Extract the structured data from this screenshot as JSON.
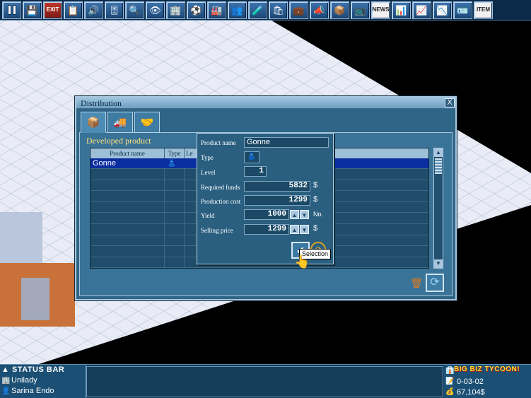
{
  "toolbar": {
    "buttons": [
      {
        "name": "pause",
        "icon": "pause-icon"
      },
      {
        "name": "save",
        "icon": "floppy-disk-icon",
        "glyph": "💾"
      },
      {
        "name": "exit",
        "label": "EXIT"
      },
      {
        "name": "menu",
        "icon": "notes-icon",
        "glyph": "📋"
      },
      {
        "name": "sound",
        "icon": "speaker-icon",
        "glyph": "🔊"
      },
      {
        "name": "settings",
        "icon": "sliders-icon",
        "glyph": "🎚"
      },
      {
        "name": "zoom",
        "icon": "magnifier-icon",
        "glyph": "🔍"
      },
      {
        "name": "view",
        "icon": "eye-icon",
        "glyph": "👁"
      },
      {
        "name": "buildings",
        "icon": "buildings-icon",
        "glyph": "🏢"
      },
      {
        "name": "sports",
        "icon": "soccer-ball-icon",
        "glyph": "⚽"
      },
      {
        "name": "factory",
        "icon": "factory-icon",
        "glyph": "🏭"
      },
      {
        "name": "staff",
        "icon": "people-icon",
        "glyph": "👥"
      },
      {
        "name": "research",
        "icon": "flask-icon",
        "glyph": "🧪"
      },
      {
        "name": "shop",
        "icon": "shop-icon",
        "glyph": "🛍"
      },
      {
        "name": "finance",
        "icon": "briefcase-icon",
        "glyph": "💼"
      },
      {
        "name": "advertising",
        "icon": "megaphone-icon",
        "glyph": "📣"
      },
      {
        "name": "goods",
        "icon": "box-icon",
        "glyph": "📦"
      },
      {
        "name": "tv",
        "icon": "tv-icon",
        "glyph": "📺"
      },
      {
        "name": "news",
        "label": "NEWS"
      },
      {
        "name": "data",
        "icon": "spreadsheet-icon",
        "glyph": "📊"
      },
      {
        "name": "graph",
        "icon": "line-chart-icon",
        "glyph": "📈"
      },
      {
        "name": "stats",
        "icon": "bar-chart-icon",
        "glyph": "📉"
      },
      {
        "name": "profile",
        "icon": "id-card-icon",
        "glyph": "🪪"
      },
      {
        "name": "item",
        "label": "ITEM"
      }
    ]
  },
  "window": {
    "title": "Distribution",
    "close_label": "X",
    "tabs": [
      {
        "name": "products",
        "icon": "product-box-icon",
        "glyph": "📦"
      },
      {
        "name": "transport",
        "icon": "truck-icon",
        "glyph": "🚚"
      },
      {
        "name": "contract",
        "icon": "handshake-icon",
        "glyph": "🤝"
      }
    ],
    "section_label": "Developed product",
    "table": {
      "columns": [
        "Product name",
        "Type",
        "Le"
      ],
      "rows": [
        {
          "name": "Gonne",
          "type_icon": "dress-icon",
          "type_glyph": "👗",
          "selected": true
        }
      ]
    }
  },
  "detail": {
    "product_name_label": "Product name",
    "product_name": "Gonne",
    "type_label": "Type",
    "type_glyph": "👗",
    "level_label": "Level",
    "level": "1",
    "required_funds_label": "Required funds",
    "required_funds": "5832",
    "production_cost_label": "Production cost",
    "production_cost": "1299",
    "yield_label": "Yield",
    "yield": "1000",
    "yield_unit": "No.",
    "selling_price_label": "Selling price",
    "selling_price": "1299",
    "currency": "$",
    "selection_tooltip": "Selection"
  },
  "status_bar": {
    "title": "STATUS BAR",
    "company": "Unilady",
    "manager": "Sarina Endo",
    "logo": "BIG BIZ TYCOON!",
    "date": "0-03-02",
    "money": "67,104$"
  },
  "colors": {
    "window_bg": "#2f6586",
    "selected_row": "#0a2ea0",
    "accent_label": "#ffe27a"
  }
}
